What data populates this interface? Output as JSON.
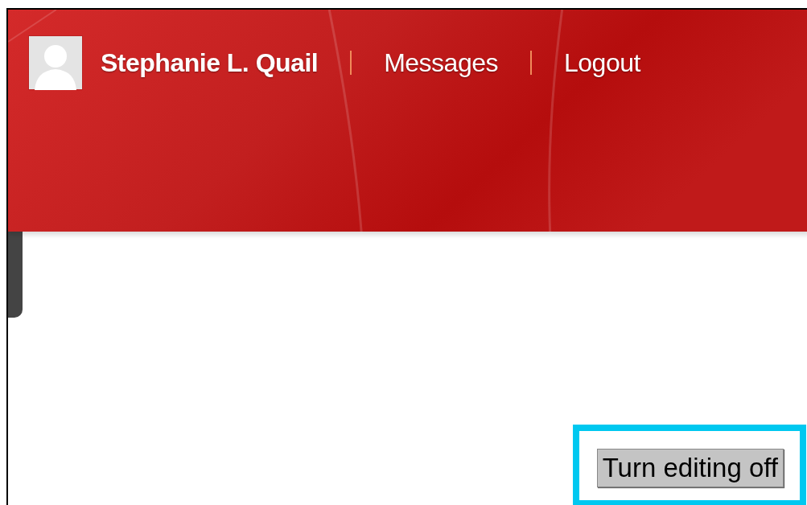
{
  "header": {
    "user_name": "Stephanie L. Quail",
    "links": [
      "Messages",
      "Logout"
    ]
  },
  "editing_button": {
    "label": "Turn editing off",
    "highlighted": true
  }
}
